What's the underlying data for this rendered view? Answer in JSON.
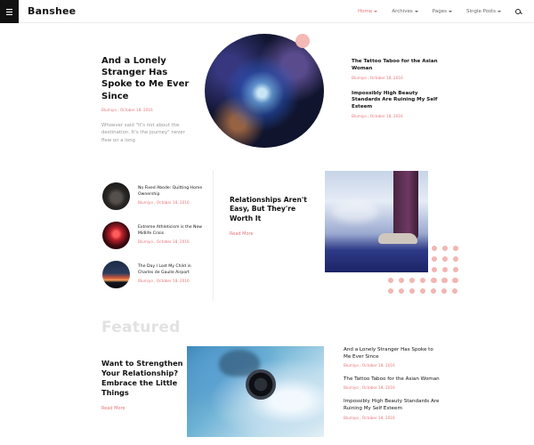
{
  "header": {
    "logo": "Banshee",
    "nav": [
      {
        "label": "Home",
        "active": true
      },
      {
        "label": "Archives",
        "active": false
      },
      {
        "label": "Pages",
        "active": false
      },
      {
        "label": "Single Posts",
        "active": false
      }
    ]
  },
  "hero": {
    "title": "And a Lonely Stranger Has Spoke to Me Ever Since",
    "meta": "Blumiyo , October 18, 2016",
    "excerpt": "Whoever said \"It's not about the destination. It's the journey\" never flew on a long",
    "side_posts": [
      {
        "title": "The Tattoo Taboo for the Asian Woman",
        "meta": "Blumiyo , October 18, 2016"
      },
      {
        "title": "Impossibly High Beauty Standards Are Ruining My Self Esteem",
        "meta": "Blumiyo , October 18, 2016"
      }
    ]
  },
  "section2": {
    "mini_posts": [
      {
        "title": "No Fixed Abode: Quitting Home Ownership",
        "meta": "Blumiyo , October 18, 2016"
      },
      {
        "title": "Extreme Athleticism is the New Midlife Crisis",
        "meta": "Blumiyo , October 18, 2016"
      },
      {
        "title": "The Day I Lost My Child in Charles de Gaulle Airport",
        "meta": "Blumiyo , October 18, 2016"
      }
    ],
    "feature": {
      "title": "Relationships Aren't Easy, But They're Worth It",
      "read_more": "Read More"
    }
  },
  "featured": {
    "heading": "Featured",
    "main": {
      "title": "Want to Strengthen Your Relationship? Embrace the Little Things",
      "read_more": "Read More"
    },
    "side_posts": [
      {
        "title": "And a Lonely Stranger Has Spoke to Me Ever Since",
        "meta": "Blumiyo , October 18, 2016"
      },
      {
        "title": "The Tattoo Taboo for the Asian Woman",
        "meta": "Blumiyo , October 18, 2016"
      },
      {
        "title": "Impossibly High Beauty Standards Are Ruining My Self Esteem",
        "meta": "Blumiyo , October 18, 2016"
      }
    ]
  },
  "colors": {
    "accent": "#e9767a",
    "dots": "#f2b6b1",
    "featured_heading": "#e2e2e2"
  }
}
